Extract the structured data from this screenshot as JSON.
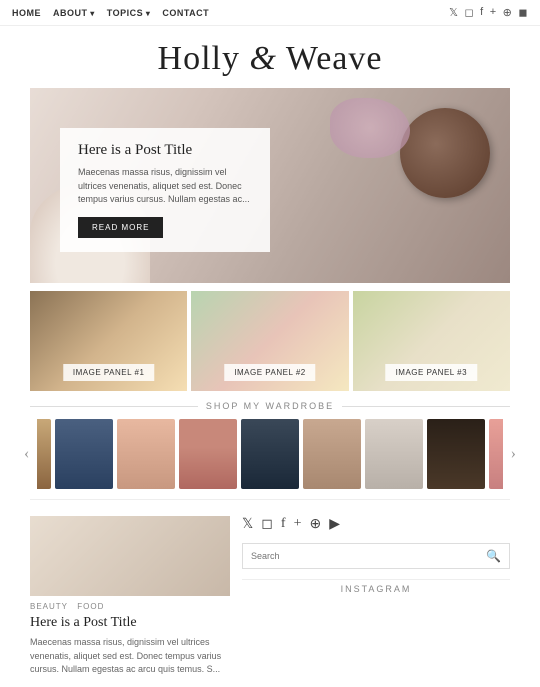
{
  "nav": {
    "items": [
      {
        "label": "HOME",
        "hasArrow": false
      },
      {
        "label": "ABOUT",
        "hasArrow": true
      },
      {
        "label": "TOPICS",
        "hasArrow": true
      },
      {
        "label": "CONTACT",
        "hasArrow": false
      }
    ],
    "social_icons": [
      "𝕏",
      "◻",
      "f",
      "+",
      "⊕",
      "◼"
    ]
  },
  "header": {
    "title": "Holly & Weave"
  },
  "hero": {
    "post_title": "Here is a Post Title",
    "excerpt": "Maecenas massa risus, dignissim vel ultrices venenatis, aliquet sed est. Donec tempus varius cursus. Nullam egestas ac...",
    "read_more": "READ MORE"
  },
  "panels": [
    {
      "label": "IMAGE PANEL #1"
    },
    {
      "label": "IMAGE PANEL #2"
    },
    {
      "label": "IMAGE PANEL #3"
    }
  ],
  "shop": {
    "title": "SHOP MY WARDROBE",
    "prev_arrow": "‹",
    "next_arrow": "›",
    "items": [
      {
        "class": "shop-item-1"
      },
      {
        "class": "shop-item-2"
      },
      {
        "class": "shop-item-3"
      },
      {
        "class": "shop-item-4"
      },
      {
        "class": "shop-item-5"
      },
      {
        "class": "shop-item-6"
      },
      {
        "class": "shop-item-7"
      },
      {
        "class": "shop-item-8"
      },
      {
        "class": "shop-item-9"
      }
    ]
  },
  "bottom_post": {
    "categories": [
      "BEAUTY",
      "FOOD"
    ],
    "title": "Here is a Post Title",
    "excerpt": "Maecenas massa risus, dignissim vel ultrices venenatis, aliquet sed est. Donec tempus varius cursus. Nullam egestas ac arcu quis temus. S..."
  },
  "sidebar": {
    "social_icons": [
      "𝕏",
      "◻",
      "f",
      "+",
      "⊕",
      "▶"
    ],
    "search_placeholder": "Search",
    "instagram_title": "INSTAGRAM"
  }
}
